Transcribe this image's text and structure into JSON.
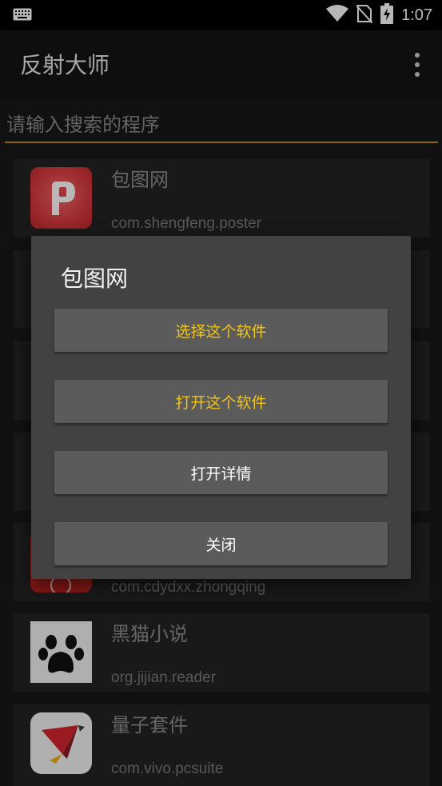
{
  "status_bar": {
    "time": "1:07",
    "icons": [
      "keyboard-icon",
      "wifi-icon",
      "no-sim-icon",
      "battery-charging-icon"
    ]
  },
  "app_bar": {
    "title": "反射大师",
    "menu_icon": "more-vert-icon"
  },
  "search": {
    "placeholder": "请输入搜索的程序",
    "value": ""
  },
  "apps": [
    {
      "name": "包图网",
      "package": "com.shengfeng.poster",
      "icon": "baotu-icon"
    },
    {
      "name": "",
      "package": "",
      "icon": ""
    },
    {
      "name": "",
      "package": "",
      "icon": ""
    },
    {
      "name": "",
      "package": "",
      "icon": ""
    },
    {
      "name": "",
      "package": "com.cdydxx.zhongqing",
      "icon": "zhongqing-icon"
    },
    {
      "name": "黑猫小说",
      "package": "org.jijian.reader",
      "icon": "cat-paw-icon"
    },
    {
      "name": "量子套件",
      "package": "com.vivo.pcsuite",
      "icon": "vivo-suite-icon"
    }
  ],
  "dialog": {
    "title": "包图网",
    "buttons": [
      {
        "label": "选择这个软件",
        "color": "#f0c419"
      },
      {
        "label": "打开这个软件",
        "color": "#f0c419"
      },
      {
        "label": "打开详情",
        "color": "#ffffff"
      },
      {
        "label": "关闭",
        "color": "#ffffff"
      }
    ]
  },
  "colors": {
    "accent": "#c48a0a",
    "dialog_bg": "#424242",
    "button_bg": "#5b5b5b"
  }
}
